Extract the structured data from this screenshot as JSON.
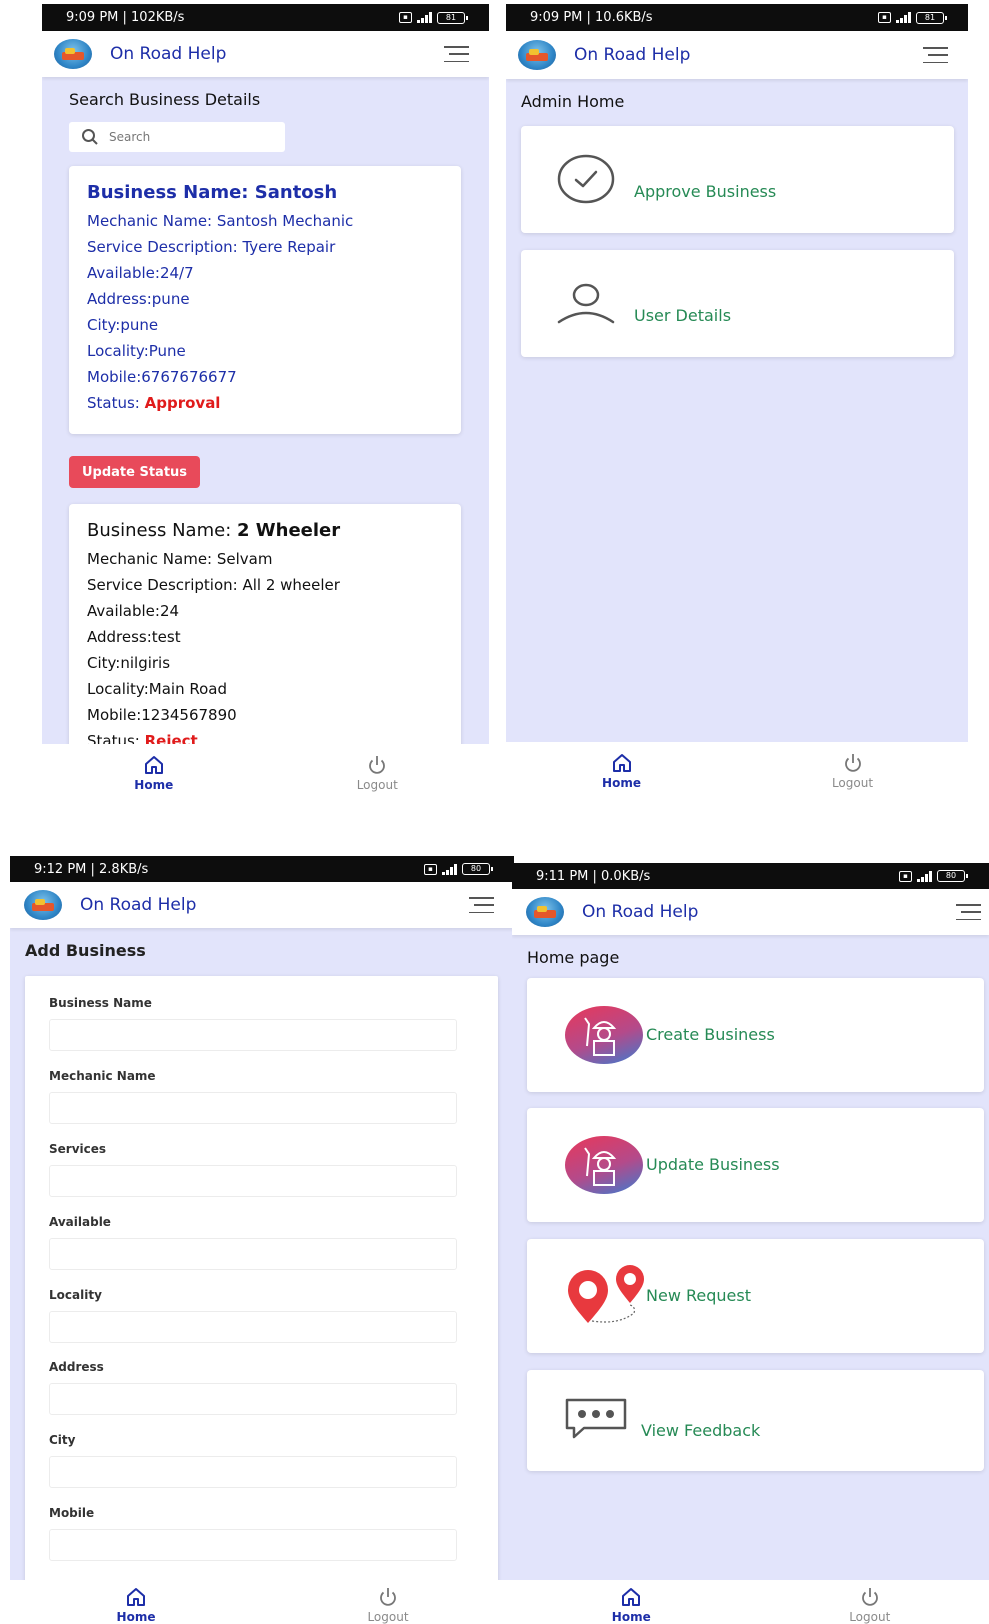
{
  "common": {
    "app_title": "On Road Help",
    "nav_home": "Home",
    "nav_logout": "Logout",
    "icons": {
      "logo": "app-logo-icon",
      "menu": "hamburger-menu-icon",
      "home": "home-icon",
      "logout": "power-icon"
    }
  },
  "screen1": {
    "status": "9:09 PM | 102KB/s",
    "battery": "81",
    "heading": "Search Business Details",
    "search_placeholder": "Search",
    "cards": [
      {
        "title_prefix": "Business Name: ",
        "title_value": "Santosh",
        "lines": [
          "Mechanic Name: Santosh Mechanic",
          "Service Description: Tyere Repair",
          "Available:24/7",
          "Address:pune",
          "City:pune",
          "Locality:Pune",
          "Mobile:6767676677"
        ],
        "status_label": "Status: ",
        "status_value": "Approval",
        "text_color": "#1d2ea8"
      },
      {
        "title_prefix": "Business Name: ",
        "title_value": "2 Wheeler",
        "lines": [
          "Mechanic Name: Selvam",
          "Service Description: All 2 wheeler",
          "Available:24",
          "Address:test",
          "City:nilgiris",
          "Locality:Main Road",
          "Mobile:1234567890"
        ],
        "status_label": "Status: ",
        "status_value": "Reject",
        "text_color": "#111111"
      }
    ],
    "update_button": "Update Status"
  },
  "screen2": {
    "status": "9:09 PM | 10.6KB/s",
    "battery": "81",
    "heading": "Admin Home",
    "items": [
      {
        "label": "Approve Business",
        "icon": "check-circle-icon"
      },
      {
        "label": "User Details",
        "icon": "user-icon"
      }
    ]
  },
  "screen3": {
    "status": "9:12 PM | 2.8KB/s",
    "battery": "80",
    "heading": "Add Business",
    "fields": [
      "Business Name",
      "Mechanic Name",
      "Services",
      "Available",
      "Locality",
      "Address",
      "City",
      "Mobile"
    ]
  },
  "screen4": {
    "status": "9:11 PM | 0.0KB/s",
    "battery": "80",
    "heading": "Home page",
    "items": [
      {
        "label": "Create Business",
        "icon": "mechanic-worker-icon"
      },
      {
        "label": "Update Business",
        "icon": "mechanic-worker-icon"
      },
      {
        "label": "New Request",
        "icon": "location-pins-icon"
      },
      {
        "label": "View Feedback",
        "icon": "chat-bubble-icon"
      }
    ]
  },
  "colors": {
    "brand_blue": "#1d2ea8",
    "accent_green": "#268a55",
    "danger_red": "#e84a5a",
    "status_red": "#e01b1b",
    "background": "#e2e4fb"
  }
}
